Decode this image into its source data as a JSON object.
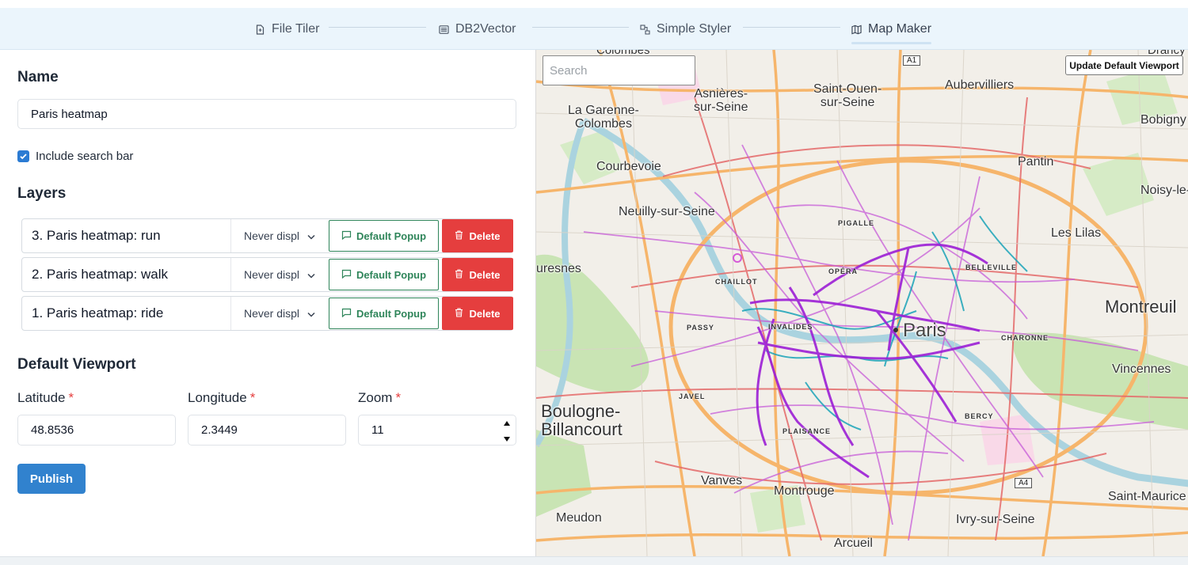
{
  "nav": {
    "tabs": [
      {
        "label": "File Tiler"
      },
      {
        "label": "DB2Vector"
      },
      {
        "label": "Simple Styler"
      },
      {
        "label": "Map Maker"
      }
    ],
    "active_tab": "Map Maker"
  },
  "form": {
    "name_heading": "Name",
    "name_value": "Paris heatmap",
    "include_search_label": "Include search bar",
    "include_search_checked": true,
    "layers_heading": "Layers",
    "layers": [
      {
        "name": "3. Paris heatmap: run",
        "display": "Never displ",
        "popup_label": "Default Popup",
        "delete_label": "Delete"
      },
      {
        "name": "2. Paris heatmap: walk",
        "display": "Never displ",
        "popup_label": "Default Popup",
        "delete_label": "Delete"
      },
      {
        "name": "1. Paris heatmap: ride",
        "display": "Never displ",
        "popup_label": "Default Popup",
        "delete_label": "Delete"
      }
    ],
    "viewport_heading": "Default Viewport",
    "latitude_label": "Latitude",
    "latitude_value": "48.8536",
    "longitude_label": "Longitude",
    "longitude_value": "2.3449",
    "zoom_label": "Zoom",
    "zoom_value": "11",
    "required_mark": "*",
    "publish_label": "Publish"
  },
  "map": {
    "search_placeholder": "Search",
    "update_viewport_label": "Update Default Viewport",
    "places": {
      "colombes": "Colombes",
      "drancy": "Drancy",
      "asnieres": "Asnières-\nsur-Seine",
      "saint_ouen": "Saint-Ouen-\nsur-Seine",
      "aubervilliers": "Aubervilliers",
      "garenne": "La Garenne-\nColombes",
      "bobigny": "Bobigny",
      "courbevoie": "Courbevoie",
      "pantin": "Pantin",
      "noisy": "Noisy-le-",
      "neuilly": "Neuilly-sur-Seine",
      "lilas": "Les Lilas",
      "suresnes": "uresnes",
      "montreuil": "Montreuil",
      "paris": "Paris",
      "vincennes": "Vincennes",
      "boulogne": "Boulogne-\nBillancourt",
      "vanves": "Vanves",
      "montrouge": "Montrouge",
      "saint_maurice": "Saint-Maurice",
      "meudon": "Meudon",
      "ivry": "Ivry-sur-Seine",
      "arcueil": "Arcueil"
    },
    "neighborhoods": {
      "pigalle": "PIGALLE",
      "chaillot": "CHAILLOT",
      "opera": "OPÉRA",
      "belleville": "BELLEVILLE",
      "passy": "PASSY",
      "invalides": "INVALIDES",
      "charonne": "CHARONNE",
      "javel": "JAVEL",
      "bercy": "BERCY",
      "plaisance": "PLAISANCE"
    },
    "shields": {
      "a1": "A1",
      "a4": "A4"
    },
    "colors": {
      "ride": "#9c1fd6",
      "walk": "#1aa3b8",
      "run": "#c75bd8",
      "main_road": "#f6b56b",
      "arterial": "#e56a6a",
      "park": "#c9e4b4",
      "water": "#aad3df"
    }
  },
  "theme": {
    "primary": "#3182ce",
    "danger": "#e53e3e",
    "success": "#2f855a",
    "nav_bg": "#ebf5fc"
  }
}
